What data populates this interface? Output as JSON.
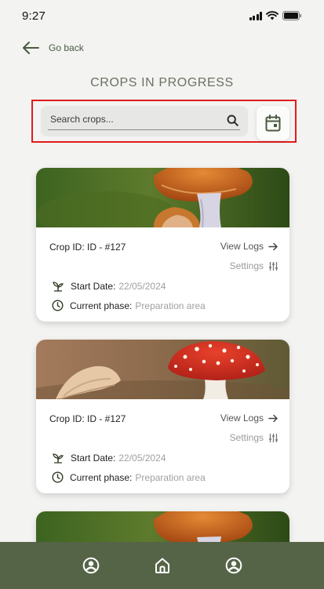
{
  "status_bar": {
    "time": "9:27"
  },
  "nav": {
    "back_label": "Go back"
  },
  "page": {
    "title": "CROPS IN PROGRESS"
  },
  "search": {
    "placeholder": "Search crops..."
  },
  "cards": [
    {
      "crop_id": "Crop ID: ID - #127",
      "view_logs": "View Logs",
      "settings": "Settings",
      "start_date_label": "Start Date:",
      "start_date_value": "22/05/2024",
      "phase_label": "Current phase:",
      "phase_value": "Preparation area"
    },
    {
      "crop_id": "Crop ID: ID - #127",
      "view_logs": "View Logs",
      "settings": "Settings",
      "start_date_label": "Start Date:",
      "start_date_value": "22/05/2024",
      "phase_label": "Current phase:",
      "phase_value": "Preparation area"
    }
  ],
  "colors": {
    "nav_bar": "#556447",
    "accent_green": "#4a5a3f",
    "highlight_border": "#e01b1b"
  },
  "icons": [
    "arrow-left-icon",
    "search-icon",
    "calendar-icon",
    "arrow-right-icon",
    "sliders-icon",
    "sprout-icon",
    "clock-icon",
    "user-icon",
    "home-icon"
  ]
}
